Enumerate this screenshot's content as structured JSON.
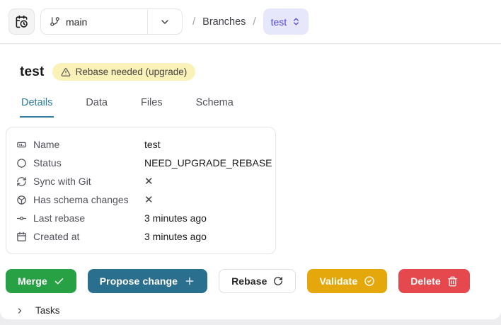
{
  "topbar": {
    "history_button": {
      "icon": "calendar-clock-icon"
    },
    "branch_selector": {
      "value": "main",
      "icon": "git-branch-icon",
      "caret_icon": "chevron-down-icon"
    },
    "breadcrumb": {
      "sep1": "/",
      "section": "Branches",
      "sep2": "/",
      "current": "test",
      "current_icon": "chevrons-up-down-icon"
    }
  },
  "header": {
    "title": "test",
    "badge": {
      "label": "Rebase needed (upgrade)",
      "icon": "warning-triangle-icon",
      "bg": "#fbf2ba"
    }
  },
  "tabs": [
    {
      "label": "Details",
      "active": true
    },
    {
      "label": "Data",
      "active": false
    },
    {
      "label": "Files",
      "active": false
    },
    {
      "label": "Schema",
      "active": false
    }
  ],
  "details": {
    "rows": [
      {
        "icon": "id-card-icon",
        "label": "Name",
        "value": "test"
      },
      {
        "icon": "circle-icon",
        "label": "Status",
        "value": "NEED_UPGRADE_REBASE"
      },
      {
        "icon": "sync-icon",
        "label": "Sync with Git",
        "value": "✕"
      },
      {
        "icon": "schema-sphere-icon",
        "label": "Has schema changes",
        "value": "✕"
      },
      {
        "icon": "git-commit-icon",
        "label": "Last rebase",
        "value": "3 minutes ago"
      },
      {
        "icon": "calendar-icon",
        "label": "Created at",
        "value": "3 minutes ago"
      }
    ]
  },
  "actions": [
    {
      "label": "Merge",
      "icon": "check-icon",
      "color": "#27a144"
    },
    {
      "label": "Propose change",
      "icon": "plus-icon",
      "color": "#2a6f8e"
    },
    {
      "label": "Rebase",
      "icon": "refresh-icon",
      "color": "#ffffff"
    },
    {
      "label": "Validate",
      "icon": "shield-check-icon",
      "color": "#e5a80c"
    },
    {
      "label": "Delete",
      "icon": "trash-icon",
      "color": "#e5484d"
    }
  ],
  "tasks": {
    "label": "Tasks",
    "icon": "chevron-right-icon"
  },
  "colors": {
    "active_tab": "#2e7ba0",
    "badge_bg": "#fbf2ba",
    "breadcrumb_pill_bg": "#e7e7fb",
    "breadcrumb_pill_text": "#4f46e5",
    "page_bg": "#ededef"
  }
}
